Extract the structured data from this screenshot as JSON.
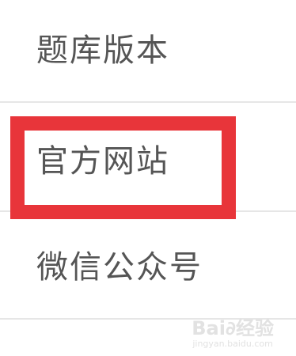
{
  "menu": {
    "items": [
      {
        "label": "题库版本"
      },
      {
        "label": "官方网站"
      },
      {
        "label": "微信公众号"
      }
    ]
  },
  "highlight_color": "#e8353a",
  "watermark": {
    "logo": "Bai∂经验",
    "url": "jingyan.baidu.com"
  }
}
